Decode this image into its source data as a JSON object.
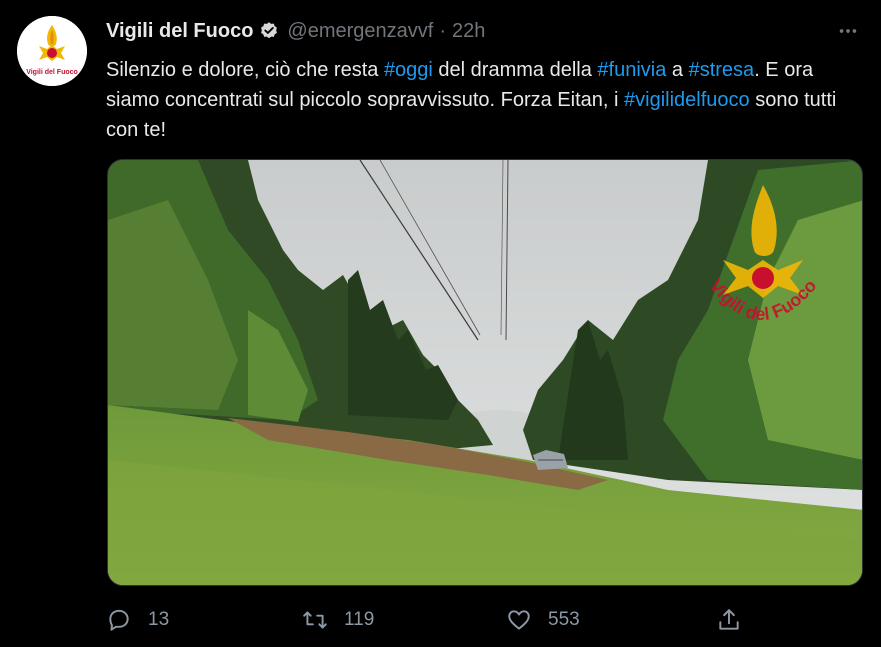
{
  "tweet": {
    "author_name": "Vigili del Fuoco",
    "handle": "@emergenzavvf",
    "separator": "·",
    "time": "22h",
    "text_parts": [
      {
        "text": "Silenzio e dolore, ciò che resta ",
        "tag": false
      },
      {
        "text": "#oggi",
        "tag": true
      },
      {
        "text": " del dramma della ",
        "tag": false
      },
      {
        "text": "#funivia",
        "tag": true
      },
      {
        "text": " a ",
        "tag": false
      },
      {
        "text": "#stresa",
        "tag": true
      },
      {
        "text": ". E ora siamo concentrati sul piccolo sopravvissuto. Forza Eitan, i ",
        "tag": false
      },
      {
        "text": "#vigilidelfuoco",
        "tag": true
      },
      {
        "text": " sono tutti con te!",
        "tag": false
      }
    ],
    "avatar_caption": "Vigili del Fuoco",
    "image_watermark": "Vigili del Fuoco"
  },
  "actions": {
    "reply_count": "13",
    "retweet_count": "119",
    "like_count": "553"
  },
  "icons": {
    "reply": "reply-icon",
    "retweet": "retweet-icon",
    "like": "heart-icon",
    "share": "share-icon",
    "more": "more-icon",
    "verified": "verified-badge-icon"
  },
  "colors": {
    "background": "#000000",
    "text": "#e7e9ea",
    "secondary": "#71767b",
    "link": "#1d9bf0",
    "brand_red": "#c8102e",
    "brand_gold": "#f2b705"
  }
}
